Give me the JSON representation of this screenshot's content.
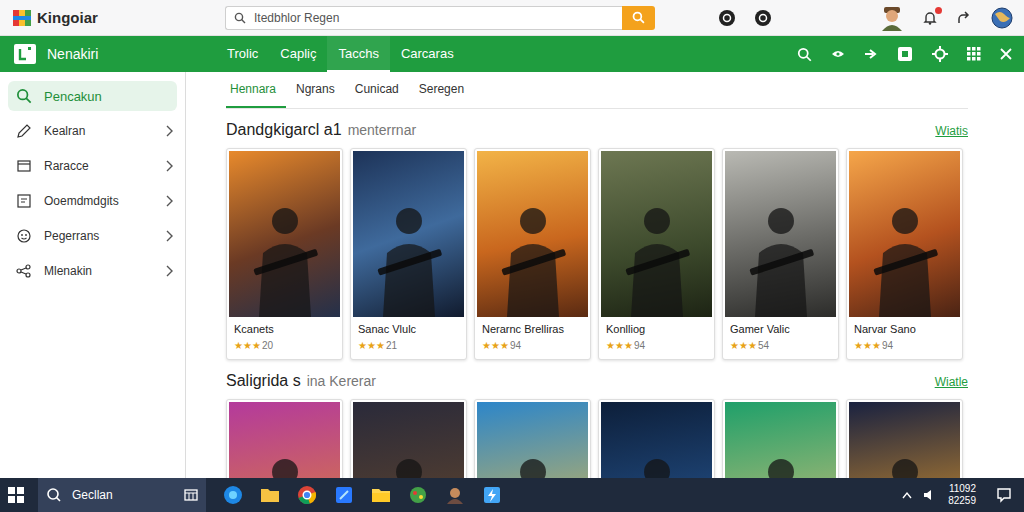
{
  "app": {
    "name": "Kingoiar"
  },
  "search": {
    "placeholder": "Itedbhlor Regen"
  },
  "nav": {
    "title": "Nenakiri",
    "tabs": [
      {
        "label": "Trolic",
        "selected": false
      },
      {
        "label": "Capliç",
        "selected": false
      },
      {
        "label": "Tacchs",
        "selected": true
      },
      {
        "label": "Carcaras",
        "selected": false
      }
    ]
  },
  "sidebar": {
    "items": [
      {
        "label": "Pencakun",
        "selected": true
      },
      {
        "label": "Kealran",
        "selected": false
      },
      {
        "label": "Raracce",
        "selected": false
      },
      {
        "label": "Ooemdmdgits",
        "selected": false
      },
      {
        "label": "Pegerrans",
        "selected": false
      },
      {
        "label": "Mlenakin",
        "selected": false
      }
    ]
  },
  "subtabs": [
    {
      "label": "Hennara",
      "selected": true
    },
    {
      "label": "Ngrans",
      "selected": false
    },
    {
      "label": "Cunicad",
      "selected": false
    },
    {
      "label": "Seregen",
      "selected": false
    }
  ],
  "sections": [
    {
      "title": "Dandgkigarcl a1",
      "subtitle": "menterrnar",
      "link": "Wiatis",
      "cards": [
        {
          "title": "Kcanets",
          "stars": 3,
          "rating": "20"
        },
        {
          "title": "Sanac Vlulc",
          "stars": 3,
          "rating": "21"
        },
        {
          "title": "Nerarnc Brelliras",
          "stars": 3,
          "rating": "94"
        },
        {
          "title": "Konlliog",
          "stars": 3,
          "rating": "94"
        },
        {
          "title": "Gamer Valic",
          "stars": 3,
          "rating": "54"
        },
        {
          "title": "Narvar Sano",
          "stars": 3,
          "rating": "94"
        }
      ]
    },
    {
      "title": "Saligrida s",
      "subtitle": "ina Kererar",
      "link": "Wiatle",
      "cards": [
        {},
        {},
        {},
        {},
        {},
        {}
      ]
    }
  ],
  "taskbar": {
    "search": "Gecllan",
    "time": "11092",
    "date": "82259"
  }
}
